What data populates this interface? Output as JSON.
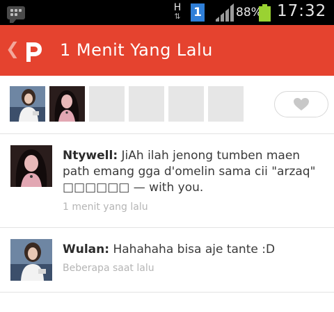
{
  "status_bar": {
    "network_type": "H",
    "sim_slot": "1",
    "battery_percent": "88%",
    "time": "17:32",
    "battery_level": 0.88
  },
  "action_bar": {
    "title": "1 Menit Yang Lalu",
    "brand_color": "#e5432f"
  },
  "likers": {
    "placeholder_count": 4
  },
  "comments": [
    {
      "name": "Ntywell:",
      "text": "JiAh ilah jenong tumben maen path emang gga d'omelin sama cii \"arzaq\" □□□□□□ — with you.",
      "time": "1 menit yang lalu"
    },
    {
      "name": "Wulan:",
      "text": "Hahahaha bisa aje tante :D",
      "time": "Beberapa saat lalu"
    }
  ]
}
